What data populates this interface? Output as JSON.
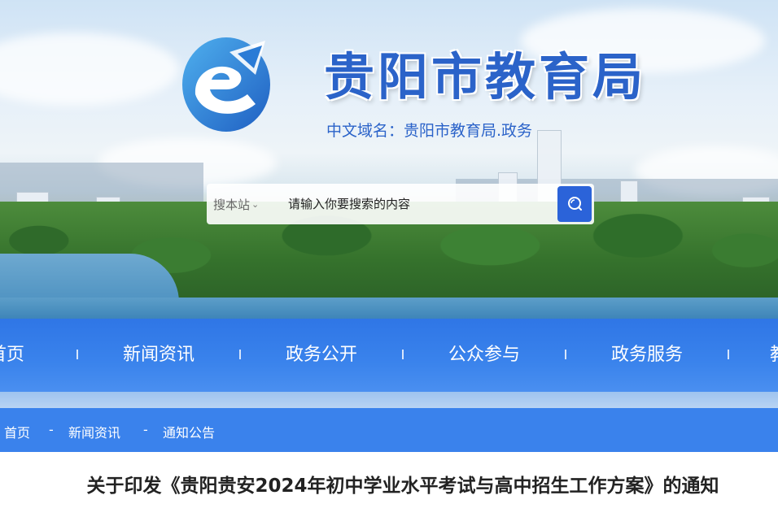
{
  "header": {
    "site_title": "贵阳市教育局",
    "domain_line": "中文域名：贵阳市教育局.政务",
    "logo_icon": "e-logo-icon"
  },
  "search": {
    "scope_label": "搜本站",
    "placeholder": "请输入你要搜索的内容",
    "button_icon": "search-icon"
  },
  "nav": {
    "items": [
      {
        "label": "首页"
      },
      {
        "label": "新闻资讯"
      },
      {
        "label": "政务公开"
      },
      {
        "label": "公众参与"
      },
      {
        "label": "政务服务"
      },
      {
        "label": "教育"
      }
    ]
  },
  "breadcrumb": {
    "home": "首页",
    "sep": "-",
    "level1": "新闻资讯",
    "level2": "通知公告"
  },
  "article": {
    "title": "关于印发《贵阳贵安2024年初中学业水平考试与高中招生工作方案》的通知"
  },
  "colors": {
    "brand_blue": "#2b63c9",
    "nav_blue": "#3a83ec",
    "search_button": "#2b63d9"
  }
}
